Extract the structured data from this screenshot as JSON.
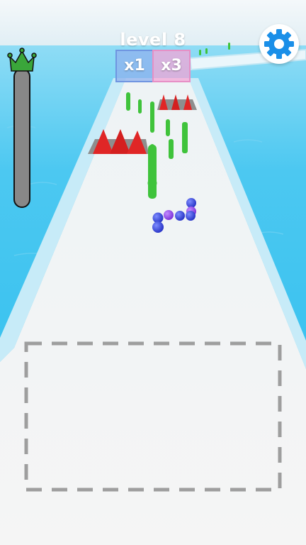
{
  "hud": {
    "level_text": "level 8",
    "level_progress": 0.0,
    "progress_icon": "bowling-pin-crown-icon",
    "settings_icon": "gear-icon"
  },
  "gates": [
    {
      "label": "x1",
      "color": "#8fb2ee"
    },
    {
      "label": "x3",
      "color": "#f3a6d6"
    }
  ],
  "colors": {
    "water": "#36c2ee",
    "track": "#f3f3f3",
    "track_edge": "#bfe6f4",
    "pins": "#3fc33b",
    "spikes": "#e02626",
    "balls_blue": "#2b3bd9",
    "balls_purple": "#8a3de0",
    "settings_accent": "#1a8fe8"
  }
}
